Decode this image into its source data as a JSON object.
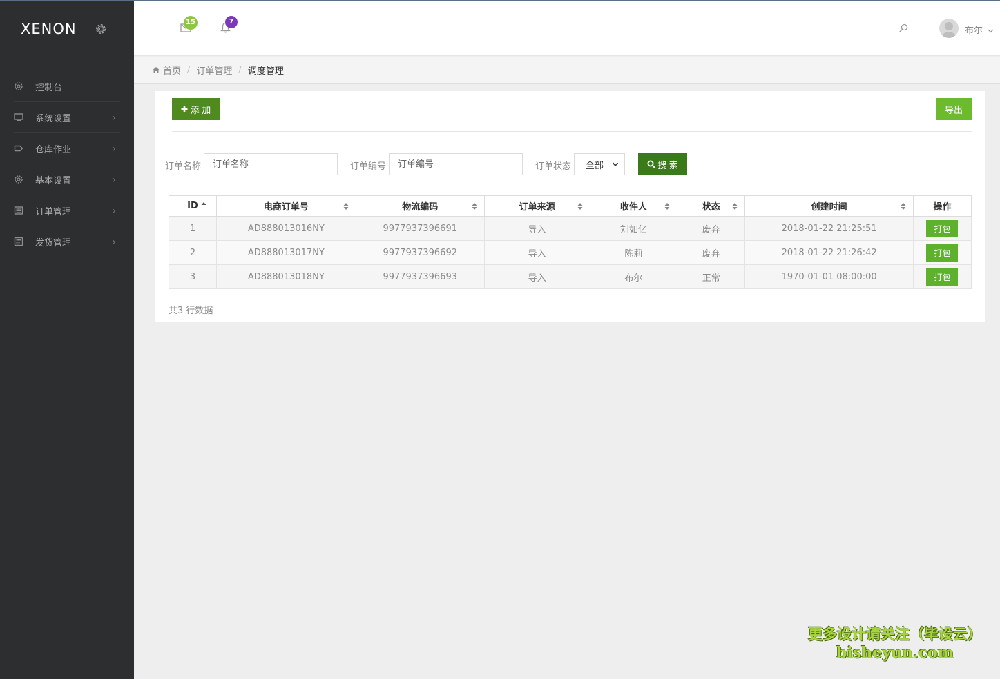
{
  "brand": {
    "logo": "XENON"
  },
  "sidebar": {
    "items": [
      {
        "label": "控制台",
        "icon": "gear-icon",
        "has_submenu": false
      },
      {
        "label": "系统设置",
        "icon": "monitor-icon",
        "has_submenu": true
      },
      {
        "label": "仓库作业",
        "icon": "tag-icon",
        "has_submenu": true
      },
      {
        "label": "基本设置",
        "icon": "gear-icon",
        "has_submenu": true
      },
      {
        "label": "订单管理",
        "icon": "list-icon",
        "has_submenu": true
      },
      {
        "label": "发货管理",
        "icon": "calculator-icon",
        "has_submenu": true
      }
    ]
  },
  "header": {
    "messages_count": "15",
    "notifications_count": "7",
    "user_name": "布尔"
  },
  "breadcrumb": {
    "home": "首页",
    "level1": "订单管理",
    "current": "调度管理"
  },
  "toolbar": {
    "add_label": "添 加",
    "export_label": "导出"
  },
  "filters": {
    "order_name_label": "订单名称",
    "order_name_placeholder": "订单名称",
    "order_no_label": "订单编号",
    "order_no_placeholder": "订单编号",
    "status_label": "订单状态",
    "status_value": "全部",
    "search_label": "搜 索"
  },
  "table": {
    "columns": [
      "ID",
      "电商订单号",
      "物流编码",
      "订单来源",
      "收件人",
      "状态",
      "创建时间",
      "操作"
    ],
    "rows": [
      [
        "1",
        "AD888013016NY",
        "9977937396691",
        "导入",
        "刘如亿",
        "废弃",
        "2018-01-22 21:25:51",
        "打包"
      ],
      [
        "2",
        "AD888013017NY",
        "9977937396692",
        "导入",
        "陈莉",
        "废弃",
        "2018-01-22 21:26:42",
        "打包"
      ],
      [
        "3",
        "AD888013018NY",
        "9977937396693",
        "导入",
        "布尔",
        "正常",
        "1970-01-01 08:00:00",
        "打包"
      ]
    ],
    "row_count_text": "共3 行数据"
  },
  "watermark": {
    "line1": "更多设计请关注（毕设云）",
    "line2": "bisheyun.com"
  },
  "colors": {
    "sidebar_bg": "#2c2e2f",
    "primary_green": "#4f8a1e",
    "light_green": "#6cbb2d",
    "badge_green": "#8dc63f",
    "badge_purple": "#7c38bc"
  }
}
